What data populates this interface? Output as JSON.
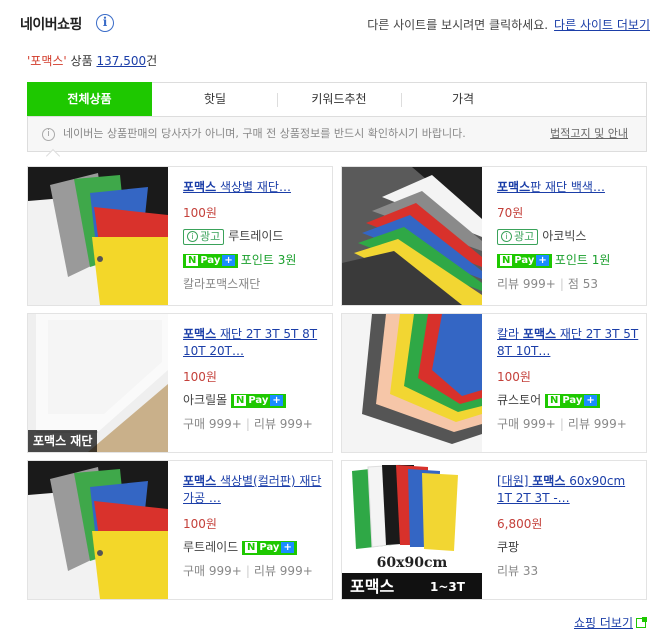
{
  "header": {
    "brand": "네이버쇼핑",
    "info_icon": "i",
    "other_site_text": "다른 사이트를 보시려면 클릭하세요.",
    "other_site_link": "다른 사이트 더보기"
  },
  "summary": {
    "keyword": "'포맥스'",
    "label": "상품",
    "count": "137,500",
    "unit": "건"
  },
  "tabs": [
    {
      "label": "전체상품",
      "active": true
    },
    {
      "label": "핫딜",
      "active": false
    },
    {
      "label": "키워드추천",
      "active": false
    },
    {
      "label": "가격",
      "active": false
    }
  ],
  "notice": {
    "icon": "i",
    "text": "네이버는 상품판매의 당사자가 아니며, 구매 전 상품정보를 반드시 확인하시기 바랍니다.",
    "link": "법적고지 및 안내"
  },
  "badges": {
    "ad": "광고",
    "ad_icon": "i",
    "npay_n": "N",
    "npay": "Pay",
    "npay_plus": "+"
  },
  "products": [
    {
      "title_bold": "포맥스",
      "title_rest": " 색상별 재단…",
      "price": "100원",
      "seller": "루트레이드",
      "point": "포인트 3원",
      "extra": "칼라포맥스재단"
    },
    {
      "title_bold": "포맥스",
      "title_rest": "판 재단 백색…",
      "price": "70원",
      "seller": "아코빅스",
      "point": "포인트 1원",
      "review": "리뷰 999+",
      "rating": "점 53"
    },
    {
      "title_bold": "포맥스",
      "title_rest": " 재단 2T 3T 5T 8T 10T 20T…",
      "price": "100원",
      "seller": "아크릴몰",
      "buy": "구매 999+",
      "review": "리뷰 999+",
      "image_label": "포맥스 재단"
    },
    {
      "title_pre": "칼라 ",
      "title_bold": "포맥스",
      "title_rest": " 재단 2T 3T 5T 8T 10T…",
      "price": "100원",
      "seller": "큐스토어",
      "buy": "구매 999+",
      "review": "리뷰 999+"
    },
    {
      "title_bold": "포맥스",
      "title_rest": " 색상별(컬러판) 재단 가공 …",
      "price": "100원",
      "seller": "루트레이드",
      "buy": "구매 999+",
      "review": "리뷰 999+"
    },
    {
      "title_pre": "[대원] ",
      "title_bold": "포맥스",
      "title_rest": " 60x90cm 1T 2T 3T -…",
      "price": "6,800원",
      "seller": "쿠팡",
      "review": "리뷰 33",
      "image_size": "60x90cm",
      "image_label": "포맥스",
      "image_range": "1~3T"
    }
  ],
  "more_link": "쇼핑 더보기"
}
